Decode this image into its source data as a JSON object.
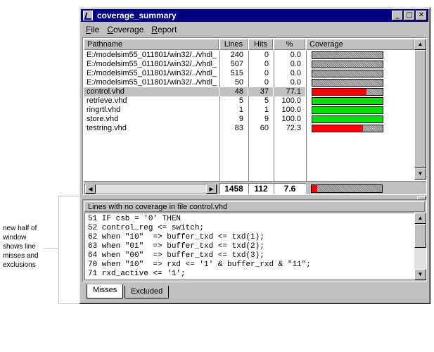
{
  "window": {
    "title": "coverage_summary",
    "menu": [
      "File",
      "Coverage",
      "Report"
    ]
  },
  "table": {
    "headers": {
      "pathname": "Pathname",
      "lines": "Lines",
      "hits": "Hits",
      "pct": "%",
      "coverage": "Coverage"
    },
    "rows": [
      {
        "path": "E:/modelsim55_011801/win32/../vhdl_",
        "lines": "240",
        "hits": "0",
        "pct": "0.0",
        "fill": 0,
        "color": "#ff0000"
      },
      {
        "path": "E:/modelsim55_011801/win32/../vhdl_",
        "lines": "507",
        "hits": "0",
        "pct": "0.0",
        "fill": 0,
        "color": "#ff0000"
      },
      {
        "path": "E:/modelsim55_011801/win32/../vhdl_",
        "lines": "515",
        "hits": "0",
        "pct": "0.0",
        "fill": 0,
        "color": "#ff0000"
      },
      {
        "path": "E:/modelsim55_011801/win32/../vhdl_",
        "lines": "50",
        "hits": "0",
        "pct": "0.0",
        "fill": 0,
        "color": "#ff0000"
      },
      {
        "path": "control.vhd",
        "lines": "48",
        "hits": "37",
        "pct": "77.1",
        "fill": 0.771,
        "color": "#ff0000",
        "selected": true
      },
      {
        "path": "retrieve.vhd",
        "lines": "5",
        "hits": "5",
        "pct": "100.0",
        "fill": 1.0,
        "color": "#00e000"
      },
      {
        "path": "ringrtl.vhd",
        "lines": "1",
        "hits": "1",
        "pct": "100.0",
        "fill": 1.0,
        "color": "#00e000"
      },
      {
        "path": "store.vhd",
        "lines": "9",
        "hits": "9",
        "pct": "100.0",
        "fill": 1.0,
        "color": "#00e000"
      },
      {
        "path": "testring.vhd",
        "lines": "83",
        "hits": "60",
        "pct": "72.3",
        "fill": 0.723,
        "color": "#ff0000"
      }
    ],
    "totals": {
      "lines": "1458",
      "hits": "112",
      "pct": "7.6",
      "fill": 0.076,
      "color": "#ff0000"
    }
  },
  "bottom": {
    "header": "Lines with no coverage in file control.vhd",
    "code": [
      "51 IF csb = '0' THEN",
      "52 control_reg <= switch;",
      "62 when \"10\"  => buffer_txd <= txd(1);",
      "63 when \"01\"  => buffer_txd <= txd(2);",
      "64 when \"00\"  => buffer_txd <= txd(3);",
      "70 when \"10\"  => rxd <= '1' & buffer_rxd & \"11\";",
      "71 rxd_active <= '1';"
    ],
    "tabs": [
      "Misses",
      "Excluded"
    ]
  },
  "callout": {
    "lines": [
      "new half of",
      "window",
      "shows line",
      "misses and",
      "exclusions"
    ]
  }
}
